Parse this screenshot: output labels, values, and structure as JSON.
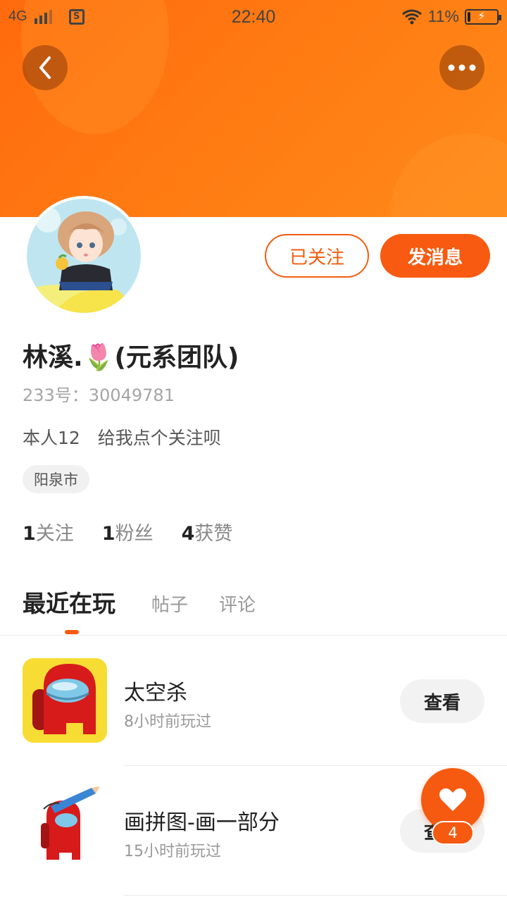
{
  "status_bar": {
    "network": "4G",
    "time": "22:40",
    "battery_pct": "11%",
    "battery_level": 0.11
  },
  "header": {
    "back_icon": "chevron-left-icon",
    "more_icon": "more-horizontal-icon",
    "colors": {
      "gradient_start": "#ff6a0e",
      "gradient_end": "#ff8a1a"
    }
  },
  "profile": {
    "nickname": "林溪.🌷(元系团队)",
    "user_id": "233号：30049781",
    "bio": "本人12　给我点个关注呗",
    "location": "阳泉市",
    "follow_label": "已关注",
    "message_label": "发消息",
    "stats": [
      {
        "num": "1",
        "label": "关注"
      },
      {
        "num": "1",
        "label": "粉丝"
      },
      {
        "num": "4",
        "label": "获赞"
      }
    ]
  },
  "tabs": [
    {
      "label": "最近在玩",
      "active": true
    },
    {
      "label": "帖子",
      "active": false
    },
    {
      "label": "评论",
      "active": false
    }
  ],
  "recent_games": [
    {
      "name": "太空杀",
      "time": "8小时前玩过",
      "action": "查看",
      "icon": "among-us-crewmate-icon"
    },
    {
      "name": "画拼图-画一部分",
      "time": "15小时前玩过",
      "action": "查看",
      "icon": "crewmate-pencil-icon"
    }
  ],
  "like_fab": {
    "icon": "heart-icon",
    "count": "4"
  },
  "accent_color": "#f75a10"
}
